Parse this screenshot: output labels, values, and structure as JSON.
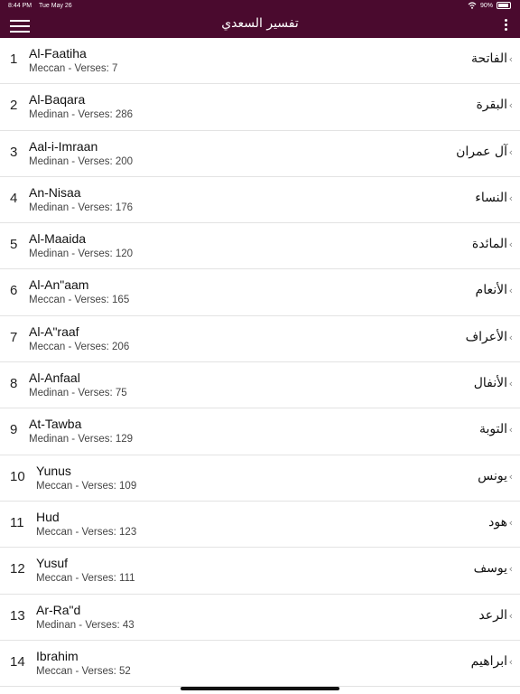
{
  "status_bar": {
    "time": "8:44 PM",
    "date": "Tue May 26",
    "battery": "90%",
    "battery_level": 0.9
  },
  "app_bar": {
    "title": "تفسير السعدي",
    "menu_icon": "hamburger-menu-icon",
    "more_icon": "vertical-dots-icon"
  },
  "colors": {
    "app_bar_bg": "#4a0a2e",
    "divider": "#e3e3e3"
  },
  "surahs": [
    {
      "number": "1",
      "name": "Al-Faatiha",
      "meta": "Meccan - Verses: 7",
      "arabic": "الفاتحة"
    },
    {
      "number": "2",
      "name": "Al-Baqara",
      "meta": "Medinan - Verses: 286",
      "arabic": "البقرة"
    },
    {
      "number": "3",
      "name": "Aal-i-Imraan",
      "meta": "Medinan - Verses: 200",
      "arabic": "آل عمران"
    },
    {
      "number": "4",
      "name": "An-Nisaa",
      "meta": "Medinan - Verses: 176",
      "arabic": "النساء"
    },
    {
      "number": "5",
      "name": "Al-Maaida",
      "meta": "Medinan - Verses: 120",
      "arabic": "المائدة"
    },
    {
      "number": "6",
      "name": "Al-An\"aam",
      "meta": "Meccan - Verses: 165",
      "arabic": "الأنعام"
    },
    {
      "number": "7",
      "name": "Al-A\"raaf",
      "meta": "Meccan - Verses: 206",
      "arabic": "الأعراف"
    },
    {
      "number": "8",
      "name": "Al-Anfaal",
      "meta": "Medinan - Verses: 75",
      "arabic": "الأنفال"
    },
    {
      "number": "9",
      "name": "At-Tawba",
      "meta": "Medinan - Verses: 129",
      "arabic": "التوبة"
    },
    {
      "number": "10",
      "name": "Yunus",
      "meta": "Meccan - Verses: 109",
      "arabic": "يونس"
    },
    {
      "number": "11",
      "name": "Hud",
      "meta": "Meccan - Verses: 123",
      "arabic": "هود"
    },
    {
      "number": "12",
      "name": "Yusuf",
      "meta": "Meccan - Verses: 111",
      "arabic": "يوسف"
    },
    {
      "number": "13",
      "name": "Ar-Ra\"d",
      "meta": "Medinan - Verses: 43",
      "arabic": "الرعد"
    },
    {
      "number": "14",
      "name": "Ibrahim",
      "meta": "Meccan - Verses: 52",
      "arabic": "ابراهيم"
    }
  ]
}
